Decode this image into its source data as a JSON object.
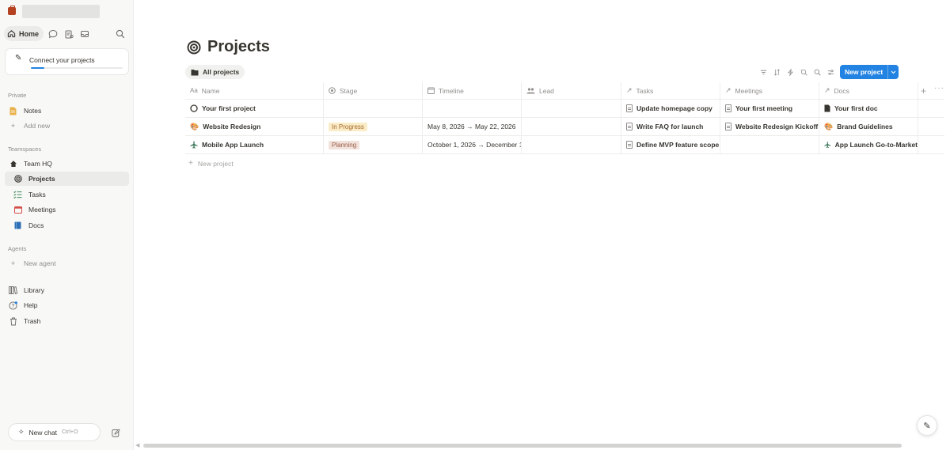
{
  "sidebar": {
    "home_label": "Home",
    "connect": {
      "title": "Connect your projects",
      "progress": 0.15
    },
    "sections": {
      "private": "Private",
      "teamspaces": "Teamspaces",
      "agents": "Agents"
    },
    "private_items": [
      {
        "label": "Notes",
        "icon": "notes-icon"
      },
      {
        "label": "Add new",
        "icon": "plus-icon"
      }
    ],
    "teamspace": {
      "label": "Team HQ",
      "icon": "home-icon"
    },
    "teamspace_items": [
      {
        "label": "Projects",
        "icon": "target-icon",
        "active": true
      },
      {
        "label": "Tasks",
        "icon": "checklist-icon"
      },
      {
        "label": "Meetings",
        "icon": "calendar-icon"
      },
      {
        "label": "Docs",
        "icon": "docs-icon"
      }
    ],
    "agent_items": [
      {
        "label": "New agent",
        "icon": "plus-icon"
      }
    ],
    "bottom_items": [
      {
        "label": "Library",
        "icon": "library-icon"
      },
      {
        "label": "Help",
        "icon": "help-icon"
      },
      {
        "label": "Trash",
        "icon": "trash-icon"
      }
    ],
    "new_chat": {
      "label": "New chat",
      "shortcut": "Ctrl+O"
    }
  },
  "page": {
    "title": "Projects",
    "view_tab": "All projects",
    "new_button": "New project"
  },
  "table": {
    "headers": {
      "name": "Name",
      "stage": "Stage",
      "timeline": "Timeline",
      "lead": "Lead",
      "tasks": "Tasks",
      "meetings": "Meetings",
      "docs": "Docs"
    },
    "rows": [
      {
        "name": "Your first project",
        "icon": "circle-icon",
        "stage": "",
        "timeline": "",
        "lead": "",
        "tasks": "Update homepage copy",
        "meetings": "Your first meeting",
        "docs": "Your first doc",
        "docs_icon": "doc-icon"
      },
      {
        "name": "Website Redesign",
        "icon": "palette-icon",
        "stage": "In Progress",
        "stage_bg": "#fbecc8",
        "stage_fg": "#a6692b",
        "timeline": "May 8, 2026 → May 22, 2026",
        "lead": "",
        "tasks": "Write FAQ for launch",
        "meetings": "Website Redesign Kickoff",
        "docs": "Brand Guidelines",
        "docs_icon": "palette-icon"
      },
      {
        "name": "Mobile App Launch",
        "icon": "airplane-icon",
        "stage": "Planning",
        "stage_bg": "#f2e2dc",
        "stage_fg": "#9a5b45",
        "timeline": "October 1, 2026 → December 1",
        "lead": "",
        "tasks": "Define MVP feature scope",
        "meetings": "",
        "docs": "App Launch Go-to-Market",
        "docs_icon": "airplane-icon"
      }
    ],
    "add_row_label": "New project"
  },
  "colors": {
    "accent": "#2383e2",
    "sidebar_bg": "#f8f8f7"
  }
}
